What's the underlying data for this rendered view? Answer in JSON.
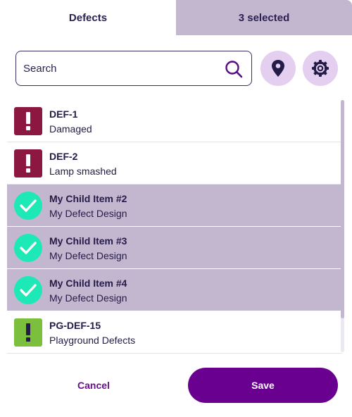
{
  "tabs": {
    "defects_label": "Defects",
    "selected_label": "3 selected"
  },
  "search": {
    "placeholder": "Search",
    "value": ""
  },
  "toolbar": {
    "map_icon": "map-pin-icon",
    "settings_icon": "gear-icon"
  },
  "items": [
    {
      "title": "DEF-1",
      "subtitle": "Damaged",
      "selected": false,
      "icon": "exclamation-icon",
      "icon_color": "#8c1741"
    },
    {
      "title": "DEF-2",
      "subtitle": "Lamp smashed",
      "selected": false,
      "icon": "exclamation-icon",
      "icon_color": "#8c1741"
    },
    {
      "title": "My Child Item #2",
      "subtitle": "My Defect Design",
      "selected": true,
      "icon": "checkmark-icon",
      "icon_color": "#1de9b6"
    },
    {
      "title": "My Child Item #3",
      "subtitle": "My Defect Design",
      "selected": true,
      "icon": "checkmark-icon",
      "icon_color": "#1de9b6"
    },
    {
      "title": "My Child Item #4",
      "subtitle": "My Defect Design",
      "selected": true,
      "icon": "checkmark-icon",
      "icon_color": "#1de9b6"
    },
    {
      "title": "PG-DEF-15",
      "subtitle": "Playground Defects",
      "selected": false,
      "icon": "exclamation-icon",
      "icon_color": "#7cbf3c"
    }
  ],
  "footer": {
    "cancel_label": "Cancel",
    "save_label": "Save"
  },
  "colors": {
    "accent": "#69008f",
    "selected_row": "#c3b6cf",
    "icon_button_bg": "#e5cff0"
  }
}
